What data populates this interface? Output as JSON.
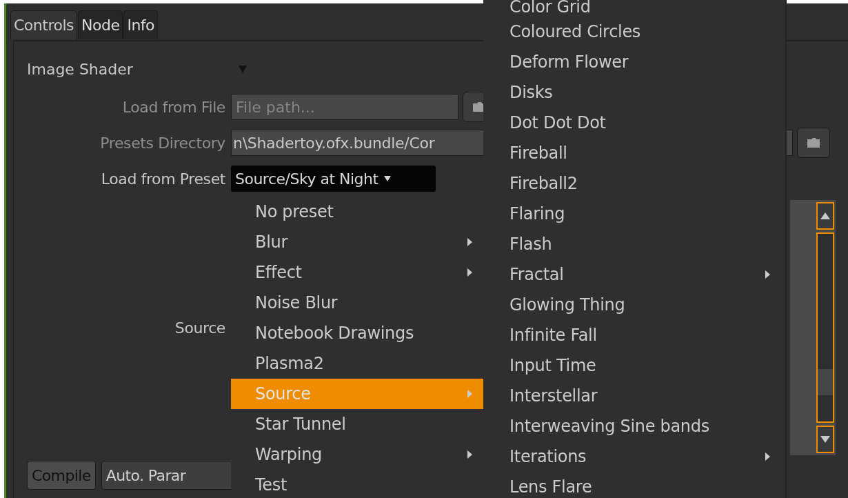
{
  "tabs": [
    {
      "label": "Controls",
      "selected": true
    },
    {
      "label": "Node",
      "selected": false
    },
    {
      "label": "Info",
      "selected": false
    }
  ],
  "group": {
    "title": "Image Shader",
    "expanded": true
  },
  "fields": [
    {
      "kind": "file",
      "label": "Load from File",
      "placeholder": "File path...",
      "disabled": true
    },
    {
      "kind": "path",
      "label": "Presets Directory",
      "value": "n\\Shadertoy.ofx.bundle/Cor",
      "disabled": true
    },
    {
      "kind": "choice",
      "label": "Load from Preset",
      "value": "Source/Sky at Night",
      "disabled": false
    }
  ],
  "source_label": "Source",
  "buttons": [
    {
      "label": "Compile",
      "down": true
    },
    {
      "label": "Auto. Parar",
      "down": false
    }
  ],
  "preset_menu": {
    "items": [
      {
        "label": "No preset",
        "has_submenu": false,
        "selected": false
      },
      {
        "label": "Blur",
        "has_submenu": true,
        "selected": false
      },
      {
        "label": "Effect",
        "has_submenu": true,
        "selected": false
      },
      {
        "label": "Noise Blur",
        "has_submenu": false,
        "selected": false
      },
      {
        "label": "Notebook Drawings",
        "has_submenu": false,
        "selected": false
      },
      {
        "label": "Plasma2",
        "has_submenu": false,
        "selected": false
      },
      {
        "label": "Source",
        "has_submenu": true,
        "selected": true
      },
      {
        "label": "Star Tunnel",
        "has_submenu": false,
        "selected": false
      },
      {
        "label": "Warping",
        "has_submenu": true,
        "selected": false
      },
      {
        "label": "Test",
        "has_submenu": false,
        "selected": false
      }
    ]
  },
  "source_submenu": {
    "items": [
      {
        "label": "Color Grid",
        "has_submenu": false
      },
      {
        "label": "Coloured Circles",
        "has_submenu": false
      },
      {
        "label": "Deform Flower",
        "has_submenu": false
      },
      {
        "label": "Disks",
        "has_submenu": false
      },
      {
        "label": "Dot Dot Dot",
        "has_submenu": false
      },
      {
        "label": "Fireball",
        "has_submenu": false
      },
      {
        "label": "Fireball2",
        "has_submenu": false
      },
      {
        "label": "Flaring",
        "has_submenu": false
      },
      {
        "label": "Flash",
        "has_submenu": false
      },
      {
        "label": "Fractal",
        "has_submenu": true
      },
      {
        "label": "Glowing Thing",
        "has_submenu": false
      },
      {
        "label": "Infinite Fall",
        "has_submenu": false
      },
      {
        "label": "Input Time",
        "has_submenu": false
      },
      {
        "label": "Interstellar",
        "has_submenu": false
      },
      {
        "label": "Interweaving Sine bands",
        "has_submenu": false
      },
      {
        "label": "Iterations",
        "has_submenu": true
      },
      {
        "label": "Lens Flare",
        "has_submenu": false
      }
    ]
  }
}
